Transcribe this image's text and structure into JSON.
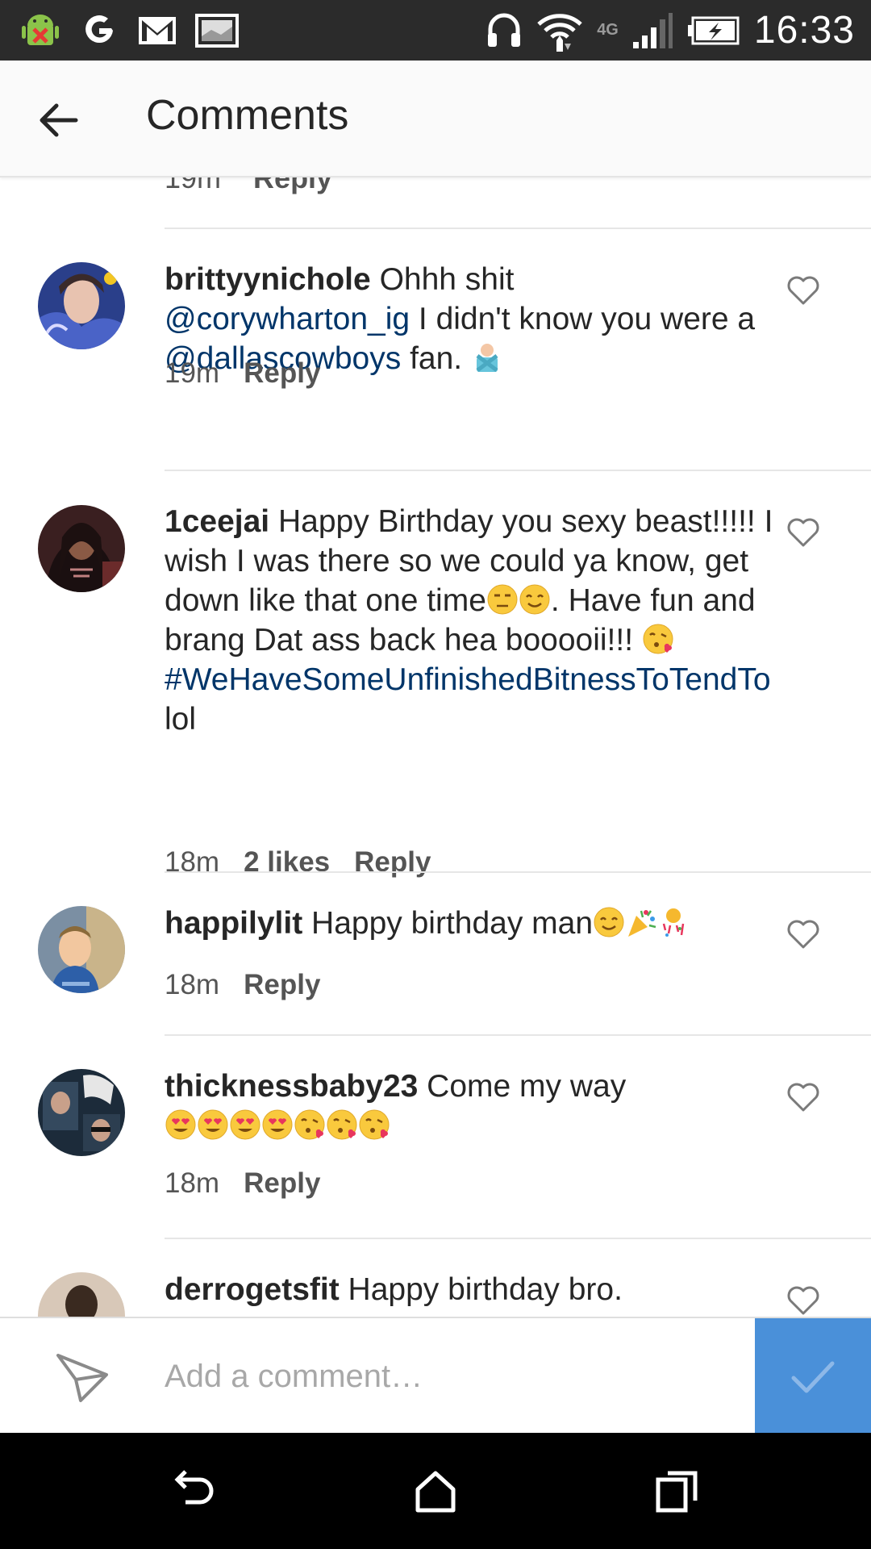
{
  "status_bar": {
    "time": "16:33",
    "network": "4G",
    "icons": [
      "android-debug-icon",
      "google-icon",
      "gmail-icon",
      "gallery-icon",
      "headphones-icon",
      "wifi-icon",
      "signal-icon",
      "battery-charging-icon"
    ]
  },
  "header": {
    "title": "Comments",
    "back_icon": "arrow-left-icon"
  },
  "partial_comment": {
    "time": "19m",
    "reply": "Reply"
  },
  "comments": [
    {
      "username": "brittyynichole",
      "text_1": "Ohhh shit",
      "mention_1": "@corywharton_ig",
      "text_2": "I didn't know you were a",
      "mention_2": "@dallascowboys",
      "text_3": "fan.",
      "emoji": [
        "person-gesturing-no-icon"
      ],
      "time": "19m",
      "reply": "Reply"
    },
    {
      "username": "1ceejai",
      "text_1": "Happy Birthday you sexy beast!!!!! I wish I was there so we could ya know, get down like that one time",
      "text_2": ". Have fun and brang Dat ass back hea booooii!!!",
      "hashtag": "#WeHaveSomeUnfinishedBitnessToTendTo",
      "text_3": "lol",
      "emoji": [
        "unamused-face-icon",
        "smiling-face-icon",
        "kissing-heart-face-icon"
      ],
      "time": "18m",
      "likes": "2 likes",
      "reply": "Reply"
    },
    {
      "username": "happilylit",
      "text_1": "Happy birthday man",
      "emoji": [
        "smiling-face-icon",
        "party-popper-icon",
        "confetti-ball-icon"
      ],
      "time": "18m",
      "reply": "Reply"
    },
    {
      "username": "thicknessbaby23",
      "text_1": "Come my way",
      "emoji": [
        "heart-eyes-icon",
        "heart-eyes-icon",
        "heart-eyes-icon",
        "heart-eyes-icon",
        "kissing-heart-face-icon",
        "kissing-heart-face-icon",
        "kissing-heart-face-icon"
      ],
      "time": "18m",
      "reply": "Reply"
    },
    {
      "username": "derrogetsfit",
      "text_1": "Happy birthday bro."
    }
  ],
  "composer": {
    "placeholder": "Add a comment…",
    "send_icon": "paper-plane-icon",
    "post_icon": "checkmark-icon"
  },
  "navbar": {
    "icons": [
      "back-nav-icon",
      "home-nav-icon",
      "recents-nav-icon"
    ]
  },
  "colors": {
    "link": "#003569",
    "post_button": "#4a90d9",
    "status_bar": "#2b2b2b",
    "header_bg": "#fafafa"
  }
}
